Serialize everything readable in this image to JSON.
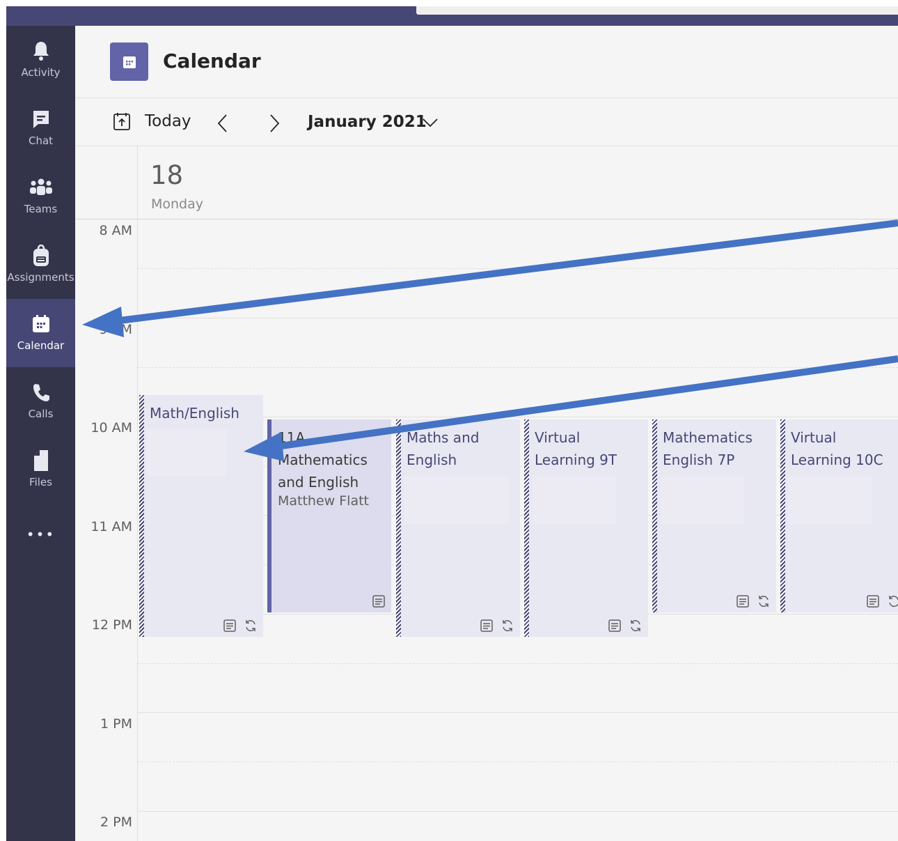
{
  "rail": {
    "items": [
      {
        "label": "Activity",
        "icon": "bell-icon"
      },
      {
        "label": "Chat",
        "icon": "chat-icon"
      },
      {
        "label": "Teams",
        "icon": "teams-icon"
      },
      {
        "label": "Assignments",
        "icon": "backpack-icon"
      },
      {
        "label": "Calendar",
        "icon": "calendar-icon",
        "active": true
      },
      {
        "label": "Calls",
        "icon": "phone-icon"
      },
      {
        "label": "Files",
        "icon": "file-icon"
      }
    ],
    "more": "•••"
  },
  "header": {
    "title": "Calendar"
  },
  "toolbar": {
    "today_label": "Today",
    "month_label": "January 2021"
  },
  "day": {
    "number": "18",
    "name": "Monday"
  },
  "times": [
    "8 AM",
    "9 AM",
    "10 AM",
    "11 AM",
    "12 PM",
    "1 PM",
    "2 PM"
  ],
  "events": [
    {
      "title": "Math/English",
      "organizer": ""
    },
    {
      "title": "11A Mathematics and English",
      "organizer": "Matthew Flatt"
    },
    {
      "title": "Maths and English",
      "organizer": ""
    },
    {
      "title": "Virtual Learning 9T",
      "organizer": ""
    },
    {
      "title": "Mathematics English 7P",
      "organizer": ""
    },
    {
      "title": "Virtual Learning 10C",
      "organizer": ""
    }
  ],
  "colors": {
    "brand": "#6264a7",
    "rail": "#33344a",
    "topbar": "#464775",
    "arrow": "#4472c4"
  }
}
